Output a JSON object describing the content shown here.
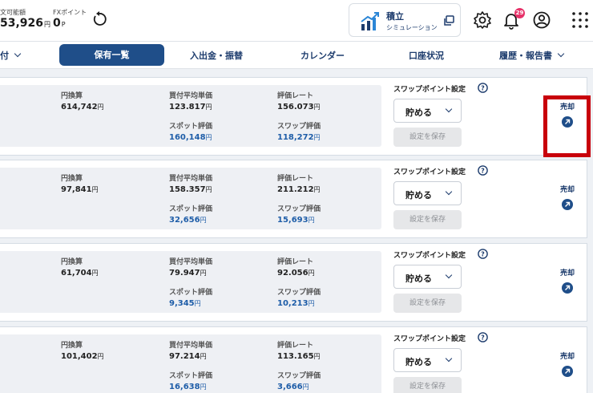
{
  "header": {
    "balance_label": "文可能額",
    "balance_value": "53,926",
    "balance_unit": "円",
    "fx_label": "FXポイント",
    "fx_value": "0",
    "fx_unit": "P",
    "tsumitate_title": "積立",
    "tsumitate_subtitle": "シミュレーション",
    "notification_count": "29"
  },
  "nav": {
    "partial_item": "付",
    "active_tab": "保有一覧",
    "items": [
      "入出金・振替",
      "カレンダー",
      "口座状況"
    ],
    "history_item": "履歴・報告書"
  },
  "labels": {
    "yen_conv": "円換算",
    "avg_price": "買付平均単価",
    "rate": "評価レート",
    "spot_eval": "スポット評価",
    "swap_eval": "スワップ評価",
    "swap_setting": "スワップポイント設定",
    "save": "設定を保存",
    "sell": "売却",
    "yen": "円"
  },
  "rows": [
    {
      "yen_conv": "614,742",
      "avg_price": "123.817",
      "rate": "156.073",
      "spot_eval": "160,148",
      "swap_eval": "118,272",
      "swap_option": "貯める"
    },
    {
      "yen_conv": "97,841",
      "avg_price": "158.357",
      "rate": "211.212",
      "spot_eval": "32,656",
      "swap_eval": "15,693",
      "swap_option": "貯める"
    },
    {
      "yen_conv": "61,704",
      "avg_price": "79.947",
      "rate": "92.056",
      "spot_eval": "9,345",
      "swap_eval": "10,213",
      "swap_option": "貯める"
    },
    {
      "yen_conv": "101,402",
      "avg_price": "97.214",
      "rate": "113.165",
      "spot_eval": "16,638",
      "swap_eval": "3,666",
      "swap_option": "貯める"
    }
  ],
  "colors": {
    "primary": "#1f4e89",
    "value_blue": "#1e5da8",
    "highlight": "#c8000b",
    "badge": "#e7336a"
  }
}
